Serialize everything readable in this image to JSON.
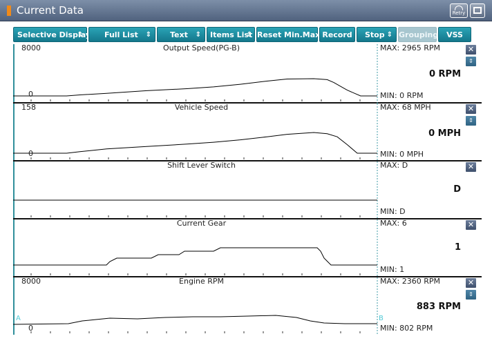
{
  "window": {
    "title": "Current Data",
    "retry_label": "Retry"
  },
  "toolbar": {
    "buttons": [
      {
        "label": "Selective Display",
        "has_arrows": true
      },
      {
        "label": "Full List",
        "has_arrows": true
      },
      {
        "label": "Text",
        "has_arrows": true
      },
      {
        "label": "Items List",
        "has_arrows": true
      },
      {
        "label": "Reset Min.Max",
        "has_arrows": false
      },
      {
        "label": "Record",
        "has_arrows": false
      },
      {
        "label": "Stop",
        "has_arrows": true
      },
      {
        "label": "Grouping",
        "has_arrows": false,
        "disabled": true
      },
      {
        "label": "VSS",
        "has_arrows": false
      }
    ],
    "arrow_glyph": "⇕"
  },
  "panels": [
    {
      "title": "Output Speed(PG-B)",
      "scale_max": "8000",
      "scale_zero": "0",
      "max_text": "MAX:   2965 RPM",
      "min_text": "MIN:    0 RPM",
      "current_value": "0 RPM",
      "has_scroll": true,
      "trace": [
        [
          0,
          0
        ],
        [
          80,
          0
        ],
        [
          100,
          180
        ],
        [
          140,
          450
        ],
        [
          200,
          900
        ],
        [
          260,
          1250
        ],
        [
          300,
          1550
        ],
        [
          340,
          2000
        ],
        [
          380,
          2550
        ],
        [
          410,
          2900
        ],
        [
          450,
          2965
        ],
        [
          470,
          2800
        ],
        [
          480,
          2300
        ],
        [
          500,
          1000
        ],
        [
          520,
          0
        ],
        [
          545,
          0
        ]
      ]
    },
    {
      "title": "Vehicle Speed",
      "scale_max": "158",
      "scale_zero": "0",
      "max_text": "MAX:   68 MPH",
      "min_text": "MIN:    0 MPH",
      "current_value": "0 MPH",
      "has_scroll": true,
      "trace": [
        [
          0,
          0
        ],
        [
          80,
          0
        ],
        [
          100,
          5
        ],
        [
          140,
          14
        ],
        [
          200,
          22
        ],
        [
          260,
          30
        ],
        [
          300,
          36
        ],
        [
          340,
          44
        ],
        [
          380,
          54
        ],
        [
          410,
          62
        ],
        [
          450,
          68
        ],
        [
          470,
          64
        ],
        [
          485,
          54
        ],
        [
          500,
          28
        ],
        [
          515,
          0
        ],
        [
          545,
          0
        ]
      ]
    },
    {
      "title": "Shift Lever Switch",
      "scale_max": "",
      "scale_zero": "",
      "max_text": "MAX: D",
      "min_text": "MIN: D",
      "current_value": "D",
      "has_scroll": false,
      "trace": []
    },
    {
      "title": "Current Gear",
      "scale_max": "",
      "scale_zero": "",
      "max_text": "MAX: 6",
      "min_text": "MIN: 1",
      "current_value": "1",
      "has_scroll": false,
      "trace": []
    },
    {
      "title": "Engine RPM",
      "scale_max": "8000",
      "scale_zero": "0",
      "max_text": "MAX:   2360 RPM",
      "min_text": "MIN:   802 RPM",
      "current_value": "883 RPM",
      "has_scroll": true,
      "trace": []
    }
  ],
  "cursor_labels": {
    "a": "A",
    "b": "B"
  },
  "icons": {
    "title_marker": "orange-bar-icon",
    "retry": "retry-icon",
    "window": "window-icon",
    "close": "close-icon",
    "scroll": "scroll-arrows-icon"
  },
  "colors": {
    "accent_button": "#1e8ea2",
    "titlebar": "#5f7190",
    "trace": "#000000",
    "cursor_line": "#3e9aa5",
    "close_button": "#55678a"
  }
}
